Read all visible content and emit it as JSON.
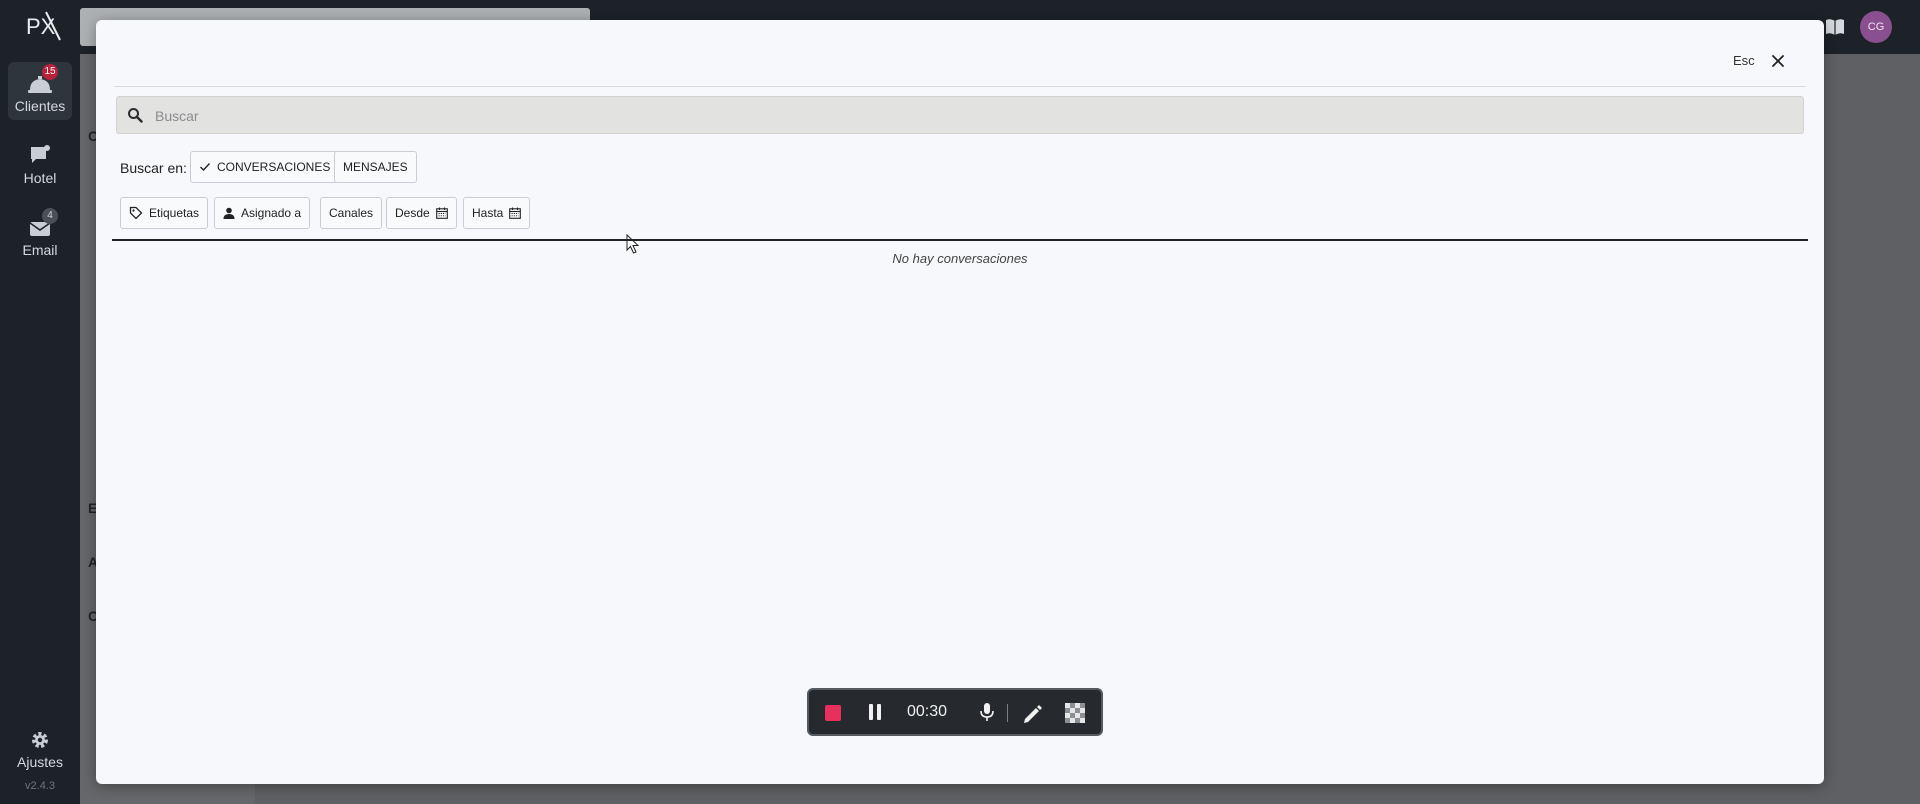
{
  "app": {
    "logo_text": "PX",
    "version": "v2.4.3",
    "user_initials": "CG"
  },
  "sidebar": {
    "items": [
      {
        "label": "Clientes",
        "badge": "15",
        "icon": "bell-service-icon"
      },
      {
        "label": "Hotel",
        "icon": "chat-icon"
      },
      {
        "label": "Email",
        "badge": "4",
        "icon": "envelope-icon"
      }
    ],
    "settings_label": "Ajustes"
  },
  "background_panel": {
    "letters": [
      "C",
      "",
      "",
      "",
      "",
      "",
      "",
      "",
      "E",
      "A",
      "C"
    ]
  },
  "modal": {
    "esc_label": "Esc",
    "search": {
      "placeholder": "Buscar",
      "value": ""
    },
    "search_in_label": "Buscar en:",
    "scopes": [
      {
        "label": "CONVERSACIONES",
        "checked": true
      },
      {
        "label": "MENSAJES",
        "checked": false
      }
    ],
    "filters": {
      "tags": "Etiquetas",
      "assigned": "Asignado a",
      "channels": "Canales",
      "from": "Desde",
      "to": "Hasta"
    },
    "empty_message": "No hay conversaciones"
  },
  "recorder": {
    "time": "00:30"
  },
  "colors": {
    "sidebar_bg": "#1d2228",
    "modal_bg": "#f6f8fb",
    "record_red": "#e8305f",
    "badge_red": "#b8213a",
    "avatar": "#8a4f8f"
  }
}
